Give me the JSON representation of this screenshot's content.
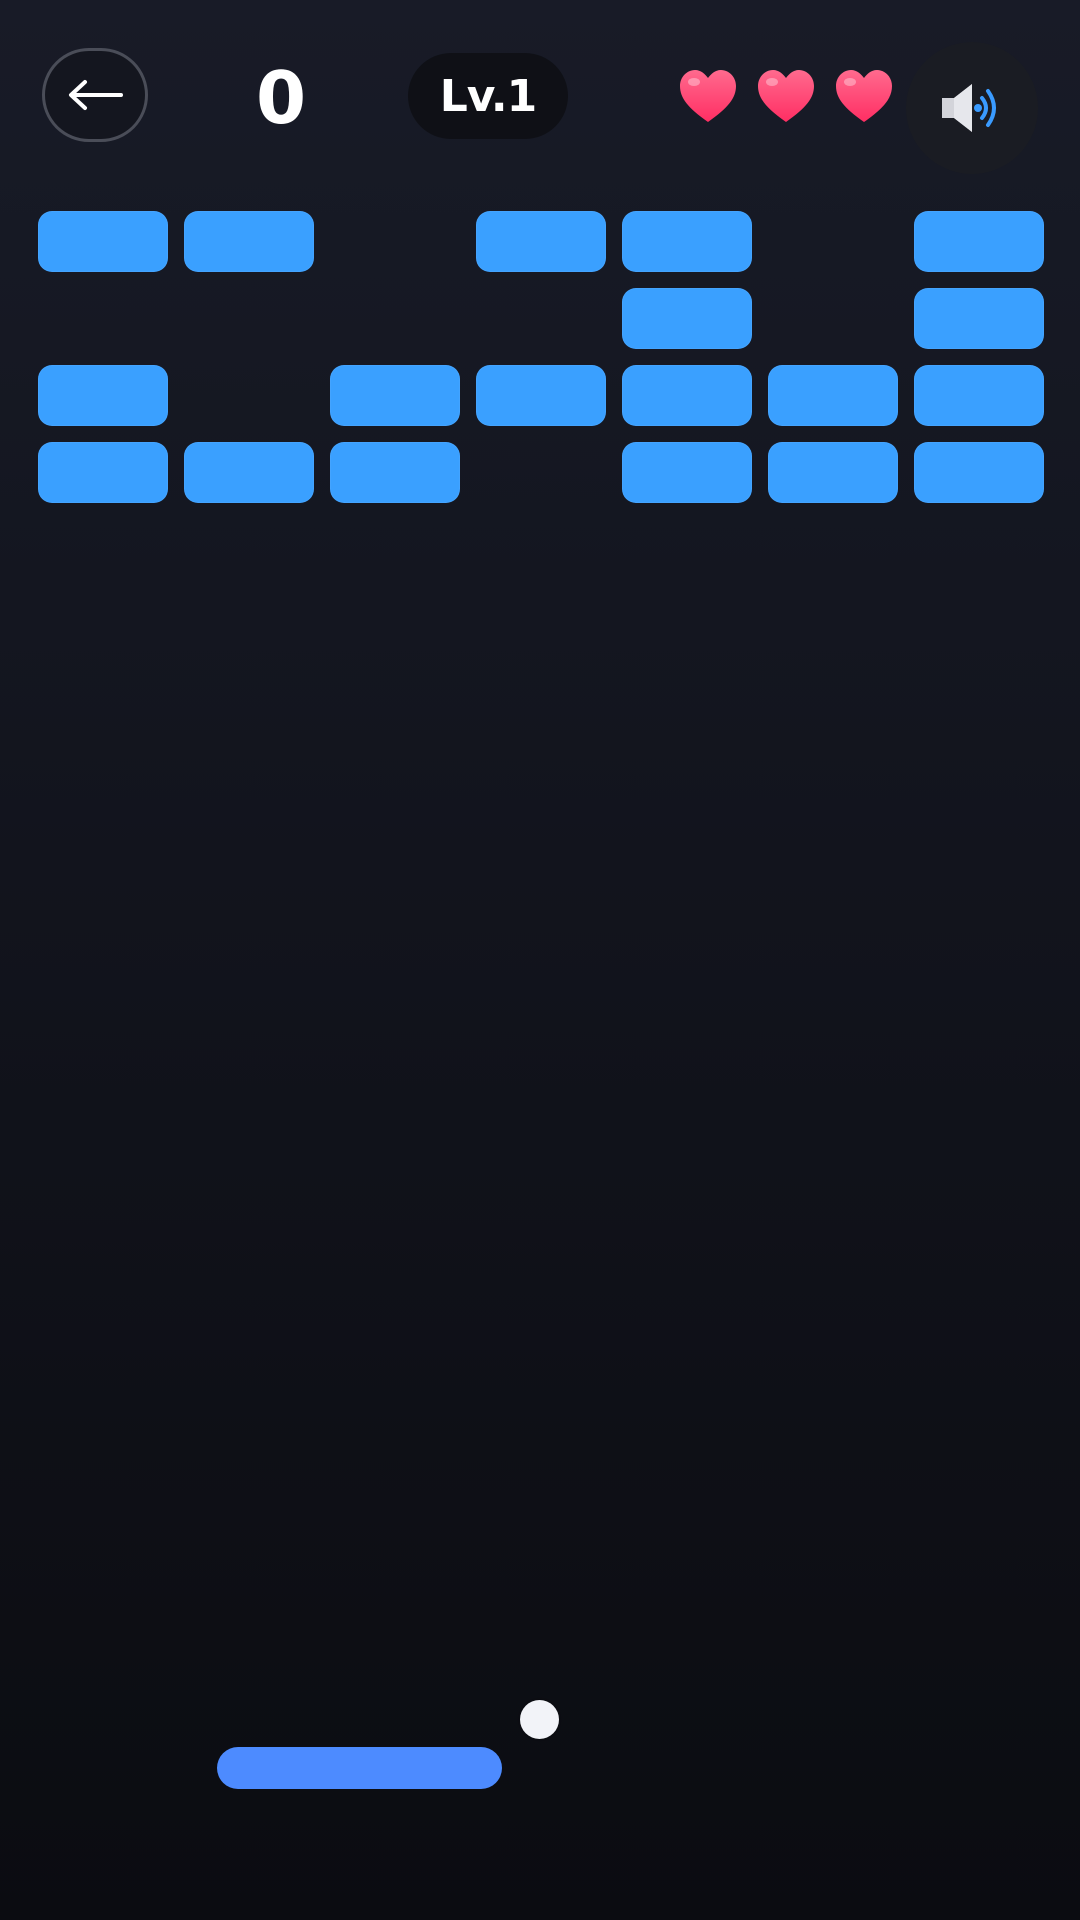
{
  "hud": {
    "back_icon": "left-arrow-icon",
    "score": "0",
    "level": "Lv.1",
    "lives": 3,
    "heart_icon": "heart-icon",
    "sound_icon": "speaker-volume-icon"
  },
  "bricks": {
    "grid": [
      [
        1,
        1,
        0,
        1,
        1,
        0,
        1
      ],
      [
        0,
        0,
        0,
        0,
        1,
        0,
        1
      ],
      [
        1,
        0,
        1,
        1,
        1,
        1,
        1
      ],
      [
        1,
        1,
        1,
        0,
        1,
        1,
        1
      ]
    ]
  },
  "colors": {
    "brick": "#3aa0ff",
    "paddle": "#4d8bff",
    "ball": "#f2f3f8",
    "heart": "#ff2e63",
    "sound_waves": "#3a9bff"
  }
}
